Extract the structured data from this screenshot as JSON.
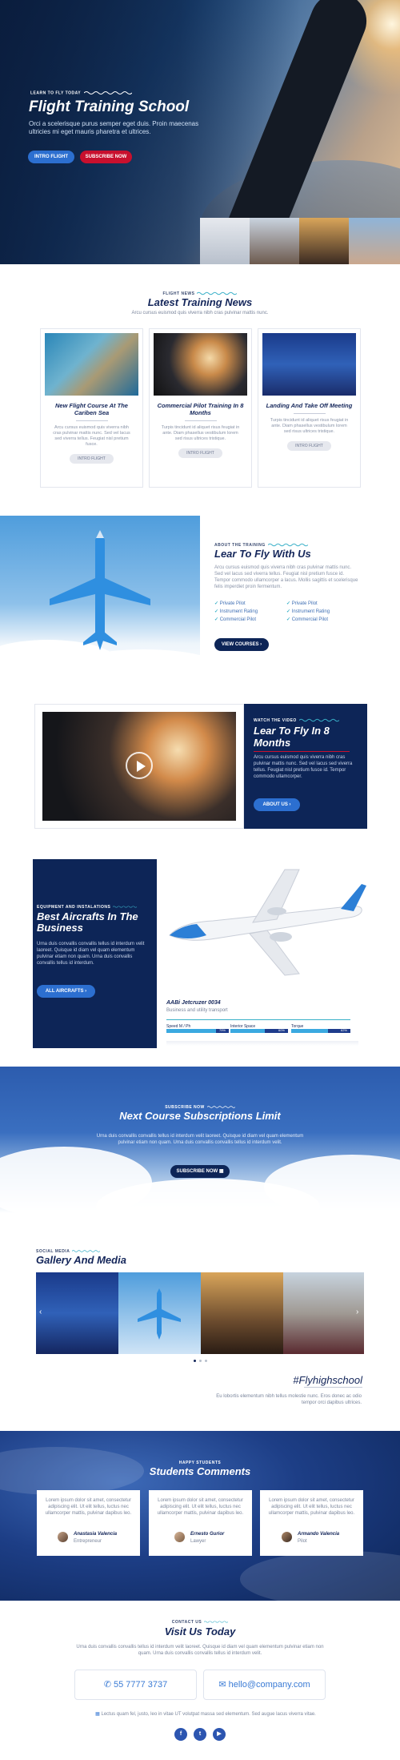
{
  "hero": {
    "eyebrow": "LEARN TO FLY TODAY",
    "title": "Flight Training School",
    "subtitle": "Orci a scelerisque purus semper eget duis. Proin maecenas ultricies mi eget mauris pharetra et ultrices.",
    "btn_primary": "INTRO FLIGHT",
    "btn_secondary": "SUBSCRIBE NOW"
  },
  "news": {
    "kicker": "FLIGHT NEWS",
    "title": "Latest Training News",
    "subtitle": "Arcu cursus euismod quis viverra nibh cras pulvinar mattis nunc.",
    "cards": [
      {
        "title": "New Flight Course At The Cariben Sea",
        "text": "Arcu cursus euismod quis viverra nibh cras pulvinar mattis nunc. Sed vel lacus sed viverra tellus. Feugiat nisl pretium fusce.",
        "button": "INTRO FLIGHT"
      },
      {
        "title": "Commercial Pilot Training In 8 Months",
        "text": "Turpis tincidunt id aliquet risus feugiat in ante. Diam phasellus vestibulum lorem sed risus ultrices tristique.",
        "button": "INTRO FLIGHT"
      },
      {
        "title": "Landing And Take Off Meeting",
        "text": "Turpis tincidunt id aliquet risus feugiat in ante. Diam phasellus vestibulum lorem sed risus ultrices tristique.",
        "button": "INTRO FLIGHT"
      }
    ]
  },
  "learn": {
    "kicker": "ABOUT THE TRAINING",
    "title": "Lear To Fly With Us",
    "text": "Arcu cursus euismod quis viverra nibh cras pulvinar mattis nunc. Sed vel lacus sed viverra tellus. Feugiat nisl pretium fusce id. Tempor commodo ullamcorper a lacus. Mollis sagittis et scelerisque felis imperdiet proin fermentum.",
    "col1": [
      "Private Pilot",
      "Instrument Rating",
      "Commercial Pilot"
    ],
    "col2": [
      "Private Pilot",
      "Instrument Rating",
      "Commercial Pilot"
    ],
    "button": "VIEW COURSES"
  },
  "video": {
    "kicker": "WATCH THE VIDEO",
    "title": "Lear To Fly In 8 Months",
    "text": "Arcu cursus euismod quis viverra nibh cras pulvinar mattis nunc. Sed vel lacus sed viverra tellus. Feugiat nisl pretium fusce id. Tempor commodo ullamcorper.",
    "button": "ABOUT US"
  },
  "aircraft": {
    "kicker": "EQUIPMENT AND INSTALATIONS",
    "title": "Best Aircrafts In The Business",
    "text": "Urna duis convallis convallis tellus id interdum velit laoreet. Quisque id diam vel quam elementum pulvinar etiam non quam. Urna duis convallis convallis tellus id interdum.",
    "button": "ALL AIRCRAFTS",
    "model": "AABi Jetcruzer 0034",
    "model_sub": "Business and utility transport",
    "specs": [
      {
        "label": "Speed M / Ph",
        "value": "79%",
        "fraction": 0.79
      },
      {
        "label": "Interior Space",
        "value": "60%",
        "fraction": 0.6
      },
      {
        "label": "Torque",
        "value": "62%",
        "fraction": 0.62
      }
    ]
  },
  "subscribe": {
    "kicker": "SUBSCRIBE NOW",
    "title": "Next Course Subscriptions Limit",
    "text": "Urna duis convallis convallis tellus id interdum velit laoreet. Quisque id diam vel quam elementum pulvinar etiam non quam. Urna duis convallis convallis tellus id interdum velit.",
    "button": "SUBSCRIBE NOW"
  },
  "gallery": {
    "kicker": "SOCIAL MEDIA",
    "title": "Gallery And Media",
    "hashtag": "#Flyhighschool",
    "text": "Eu lobortis elementum nibh tellus molestie nunc. Eros donec ac odio tempor orci dapibus ultrices."
  },
  "comments": {
    "kicker": "HAPPY STUDENTS",
    "title": "Students Comments",
    "items": [
      {
        "text": "Lorem ipsum dolor sit amet, consectetur adipiscing elit. Ut elit tellus, luctus nec ullamcorper mattis, pulvinar dapibus leo.",
        "name": "Anastasia Valencia",
        "role": "Entrepreneur"
      },
      {
        "text": "Lorem ipsum dolor sit amet, consectetur adipiscing elit. Ut elit tellus, luctus nec ullamcorper mattis, pulvinar dapibus leo.",
        "name": "Ernesto Gurior",
        "role": "Lawyer"
      },
      {
        "text": "Lorem ipsum dolor sit amet, consectetur adipiscing elit. Ut elit tellus, luctus nec ullamcorper mattis, pulvinar dapibus leo.",
        "name": "Armando Valencia",
        "role": "Pilot"
      }
    ]
  },
  "contact": {
    "kicker": "CONTACT US",
    "title": "Visit Us Today",
    "text": "Urna duis convallis convallis tellus id interdum velit laoreet. Quisque id diam vel quam elementum pulvinar etiam non quam. Urna duis convallis convallis tellus id interdum velit.",
    "phone": "55 7777 3737",
    "email": "hello@company.com",
    "address": "Lectus quam fel, justo, leo in vitae UT volutpat massa sed elementum. Sed augue lacus viverra vitae."
  },
  "colors": {
    "accent": "#2c6fd0",
    "navy": "#0d2557",
    "red": "#c8102e"
  }
}
